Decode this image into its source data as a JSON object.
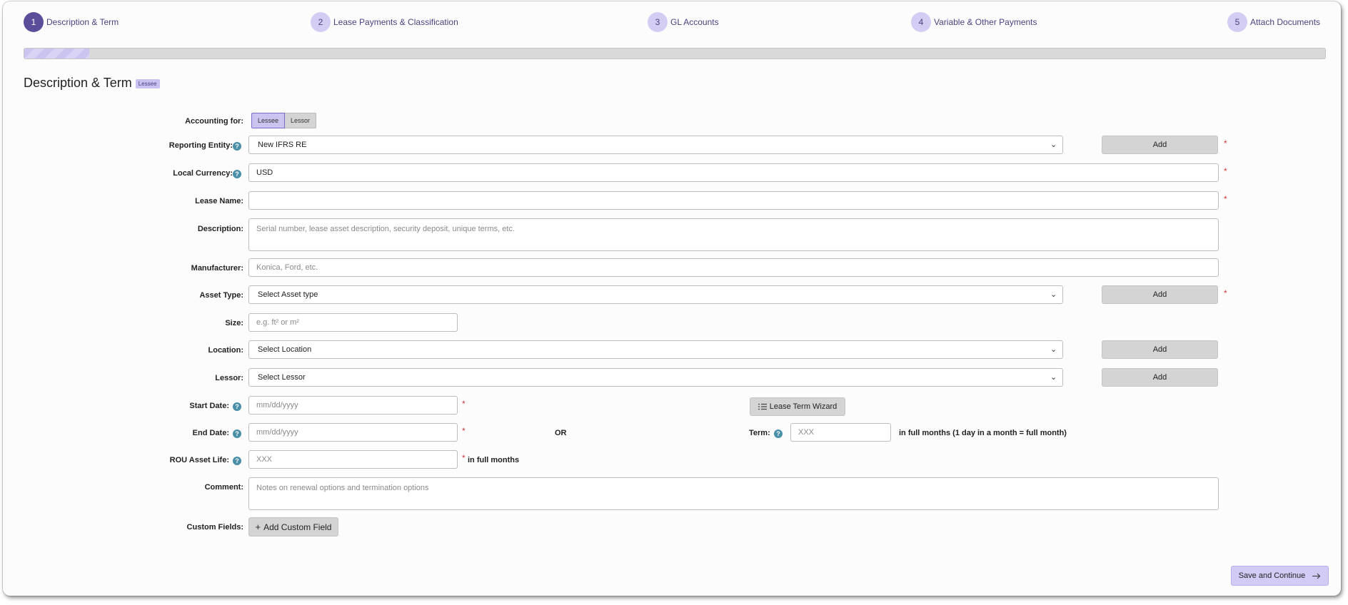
{
  "stepper": {
    "steps": [
      {
        "num": "1",
        "label": "Description & Term"
      },
      {
        "num": "2",
        "label": "Lease Payments & Classification"
      },
      {
        "num": "3",
        "label": "GL Accounts"
      },
      {
        "num": "4",
        "label": "Variable & Other Payments"
      },
      {
        "num": "5",
        "label": "Attach Documents"
      }
    ],
    "active_step": 1,
    "progress_fraction": 0.05
  },
  "section": {
    "title": "Description & Term",
    "badge": "Lessee"
  },
  "form": {
    "accounting_for": {
      "label": "Accounting for:",
      "options": [
        "Lessee",
        "Lessor"
      ],
      "selected": "Lessee"
    },
    "reporting_entity": {
      "label": "Reporting Entity:",
      "value": "New IFRS RE",
      "add_label": "Add"
    },
    "local_currency": {
      "label": "Local Currency:",
      "value": "USD"
    },
    "lease_name": {
      "label": "Lease Name:",
      "value": ""
    },
    "description": {
      "label": "Description:",
      "placeholder": "Serial number, lease asset description, security deposit, unique terms, etc."
    },
    "manufacturer": {
      "label": "Manufacturer:",
      "placeholder": "Konica, Ford, etc."
    },
    "asset_type": {
      "label": "Asset Type:",
      "value": "Select Asset type",
      "add_label": "Add"
    },
    "size": {
      "label": "Size:",
      "placeholder": "e.g. ft² or m²"
    },
    "location": {
      "label": "Location:",
      "value": "Select Location",
      "add_label": "Add"
    },
    "lessor": {
      "label": "Lessor:",
      "value": "Select Lessor",
      "add_label": "Add"
    },
    "start_date": {
      "label": "Start Date:",
      "placeholder": "mm/dd/yyyy"
    },
    "lease_term_wizard": "Lease Term Wizard",
    "end_date": {
      "label": "End Date:",
      "placeholder": "mm/dd/yyyy"
    },
    "or_text": "OR",
    "term": {
      "label": "Term:",
      "placeholder": "XXX",
      "suffix": "in full months (1 day in a month = full month)"
    },
    "rou_asset_life": {
      "label": "ROU Asset Life:",
      "placeholder": "XXX",
      "suffix": "in full months"
    },
    "comment": {
      "label": "Comment:",
      "placeholder": "Notes on renewal options and termination options"
    },
    "custom_fields": {
      "label": "Custom Fields:",
      "button": "Add Custom Field"
    },
    "required_mark": "*",
    "help_glyph": "?"
  },
  "footer": {
    "save_label": "Save and Continue"
  },
  "colors": {
    "accent": "#5b4d9a",
    "accent_light": "#d4cdf3",
    "required": "#d43a3a",
    "help": "#4a8fa8"
  }
}
